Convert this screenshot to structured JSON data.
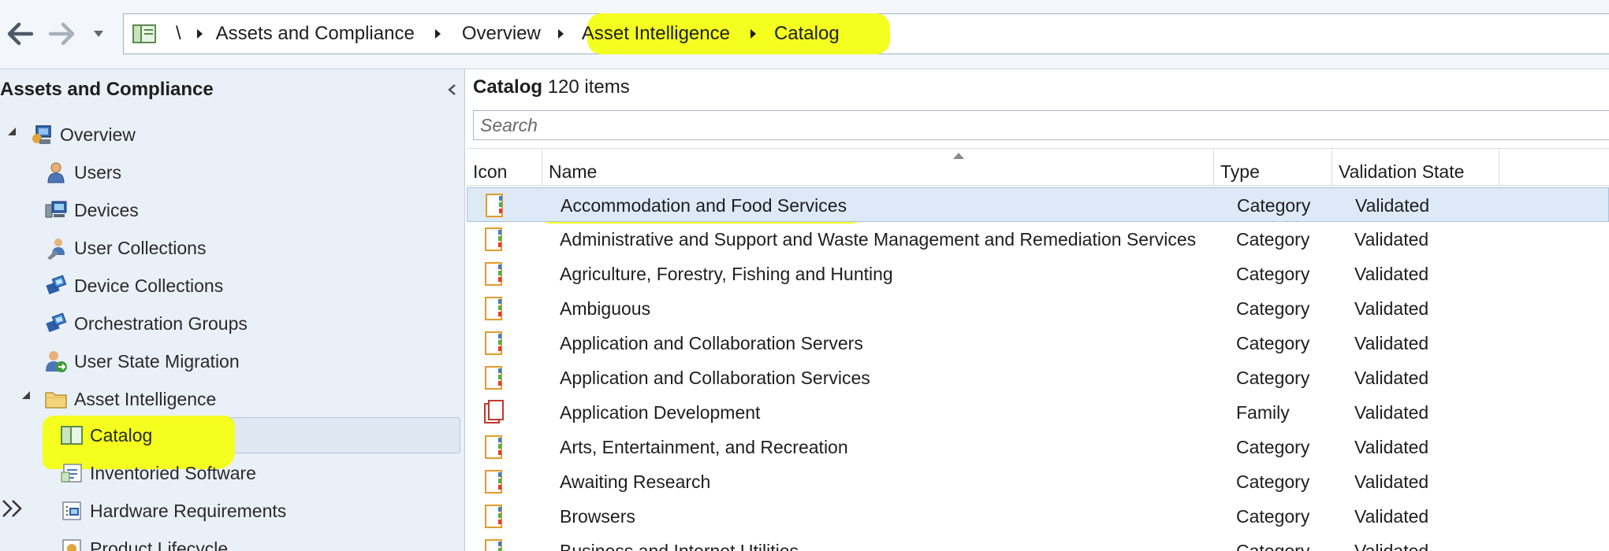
{
  "breadcrumb": {
    "root": "\\",
    "items": [
      "Assets and Compliance",
      "Overview",
      "Asset Intelligence",
      "Catalog"
    ]
  },
  "nav": {
    "title": "Assets and Compliance",
    "items": [
      {
        "label": "Overview",
        "icon": "overview-icon"
      },
      {
        "label": "Users",
        "icon": "user-icon"
      },
      {
        "label": "Devices",
        "icon": "devices-icon"
      },
      {
        "label": "User Collections",
        "icon": "user-collections-icon"
      },
      {
        "label": "Device Collections",
        "icon": "device-collections-icon"
      },
      {
        "label": "Orchestration Groups",
        "icon": "orchestration-groups-icon"
      },
      {
        "label": "User State Migration",
        "icon": "user-state-migration-icon"
      },
      {
        "label": "Asset Intelligence",
        "icon": "folder-icon"
      },
      {
        "label": "Catalog",
        "icon": "catalog-icon"
      },
      {
        "label": "Inventoried Software",
        "icon": "inventoried-software-icon"
      },
      {
        "label": "Hardware Requirements",
        "icon": "hardware-requirements-icon"
      },
      {
        "label": "Product Lifecycle",
        "icon": "product-lifecycle-icon"
      }
    ]
  },
  "main": {
    "title": "Catalog",
    "count_text": "120 items",
    "search_placeholder": "Search",
    "columns": {
      "icon": "Icon",
      "name": "Name",
      "type": "Type",
      "state": "Validation State"
    },
    "rows": [
      {
        "name": "Accommodation and Food Services",
        "type": "Category",
        "state": "Validated"
      },
      {
        "name": "Administrative and Support and Waste Management and Remediation Services",
        "type": "Category",
        "state": "Validated"
      },
      {
        "name": "Agriculture, Forestry, Fishing and Hunting",
        "type": "Category",
        "state": "Validated"
      },
      {
        "name": "Ambiguous",
        "type": "Category",
        "state": "Validated"
      },
      {
        "name": "Application and Collaboration Servers",
        "type": "Category",
        "state": "Validated"
      },
      {
        "name": "Application and Collaboration Services",
        "type": "Category",
        "state": "Validated"
      },
      {
        "name": "Application Development",
        "type": "Family",
        "state": "Validated"
      },
      {
        "name": "Arts, Entertainment, and Recreation",
        "type": "Category",
        "state": "Validated"
      },
      {
        "name": "Awaiting Research",
        "type": "Category",
        "state": "Validated"
      },
      {
        "name": "Browsers",
        "type": "Category",
        "state": "Validated"
      },
      {
        "name": "Business and Internet Utilities",
        "type": "Category",
        "state": "Validated"
      }
    ]
  },
  "colors": {
    "highlight": "#f4ff1f",
    "pane_bg": "#eaf0f8",
    "selected_row": "#dde9f6"
  }
}
